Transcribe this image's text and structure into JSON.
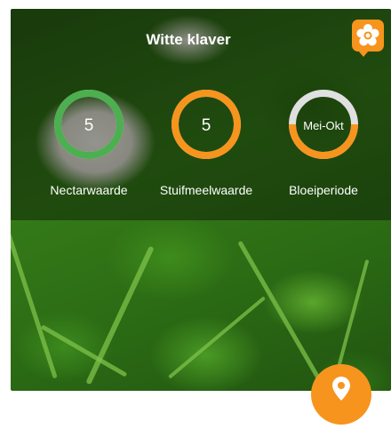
{
  "card": {
    "title": "Witte klaver",
    "flower_icon": "flower-icon",
    "indicators": [
      {
        "label": "Nectarwaarde",
        "value": "5",
        "max": 5,
        "color": "#4caf50",
        "track_color": "#e0e0e0"
      },
      {
        "label": "Stuifmeelwaarde",
        "value": "5",
        "max": 5,
        "color": "#f7941d",
        "track_color": "#e0e0e0"
      },
      {
        "label": "Bloeiperiode",
        "value": "Mei-Okt",
        "fill_fraction": 0.5,
        "color": "#f7941d",
        "track_color": "#e0e0e0"
      }
    ]
  },
  "fab": {
    "icon": "location-pin-icon",
    "color": "#f7941d"
  }
}
